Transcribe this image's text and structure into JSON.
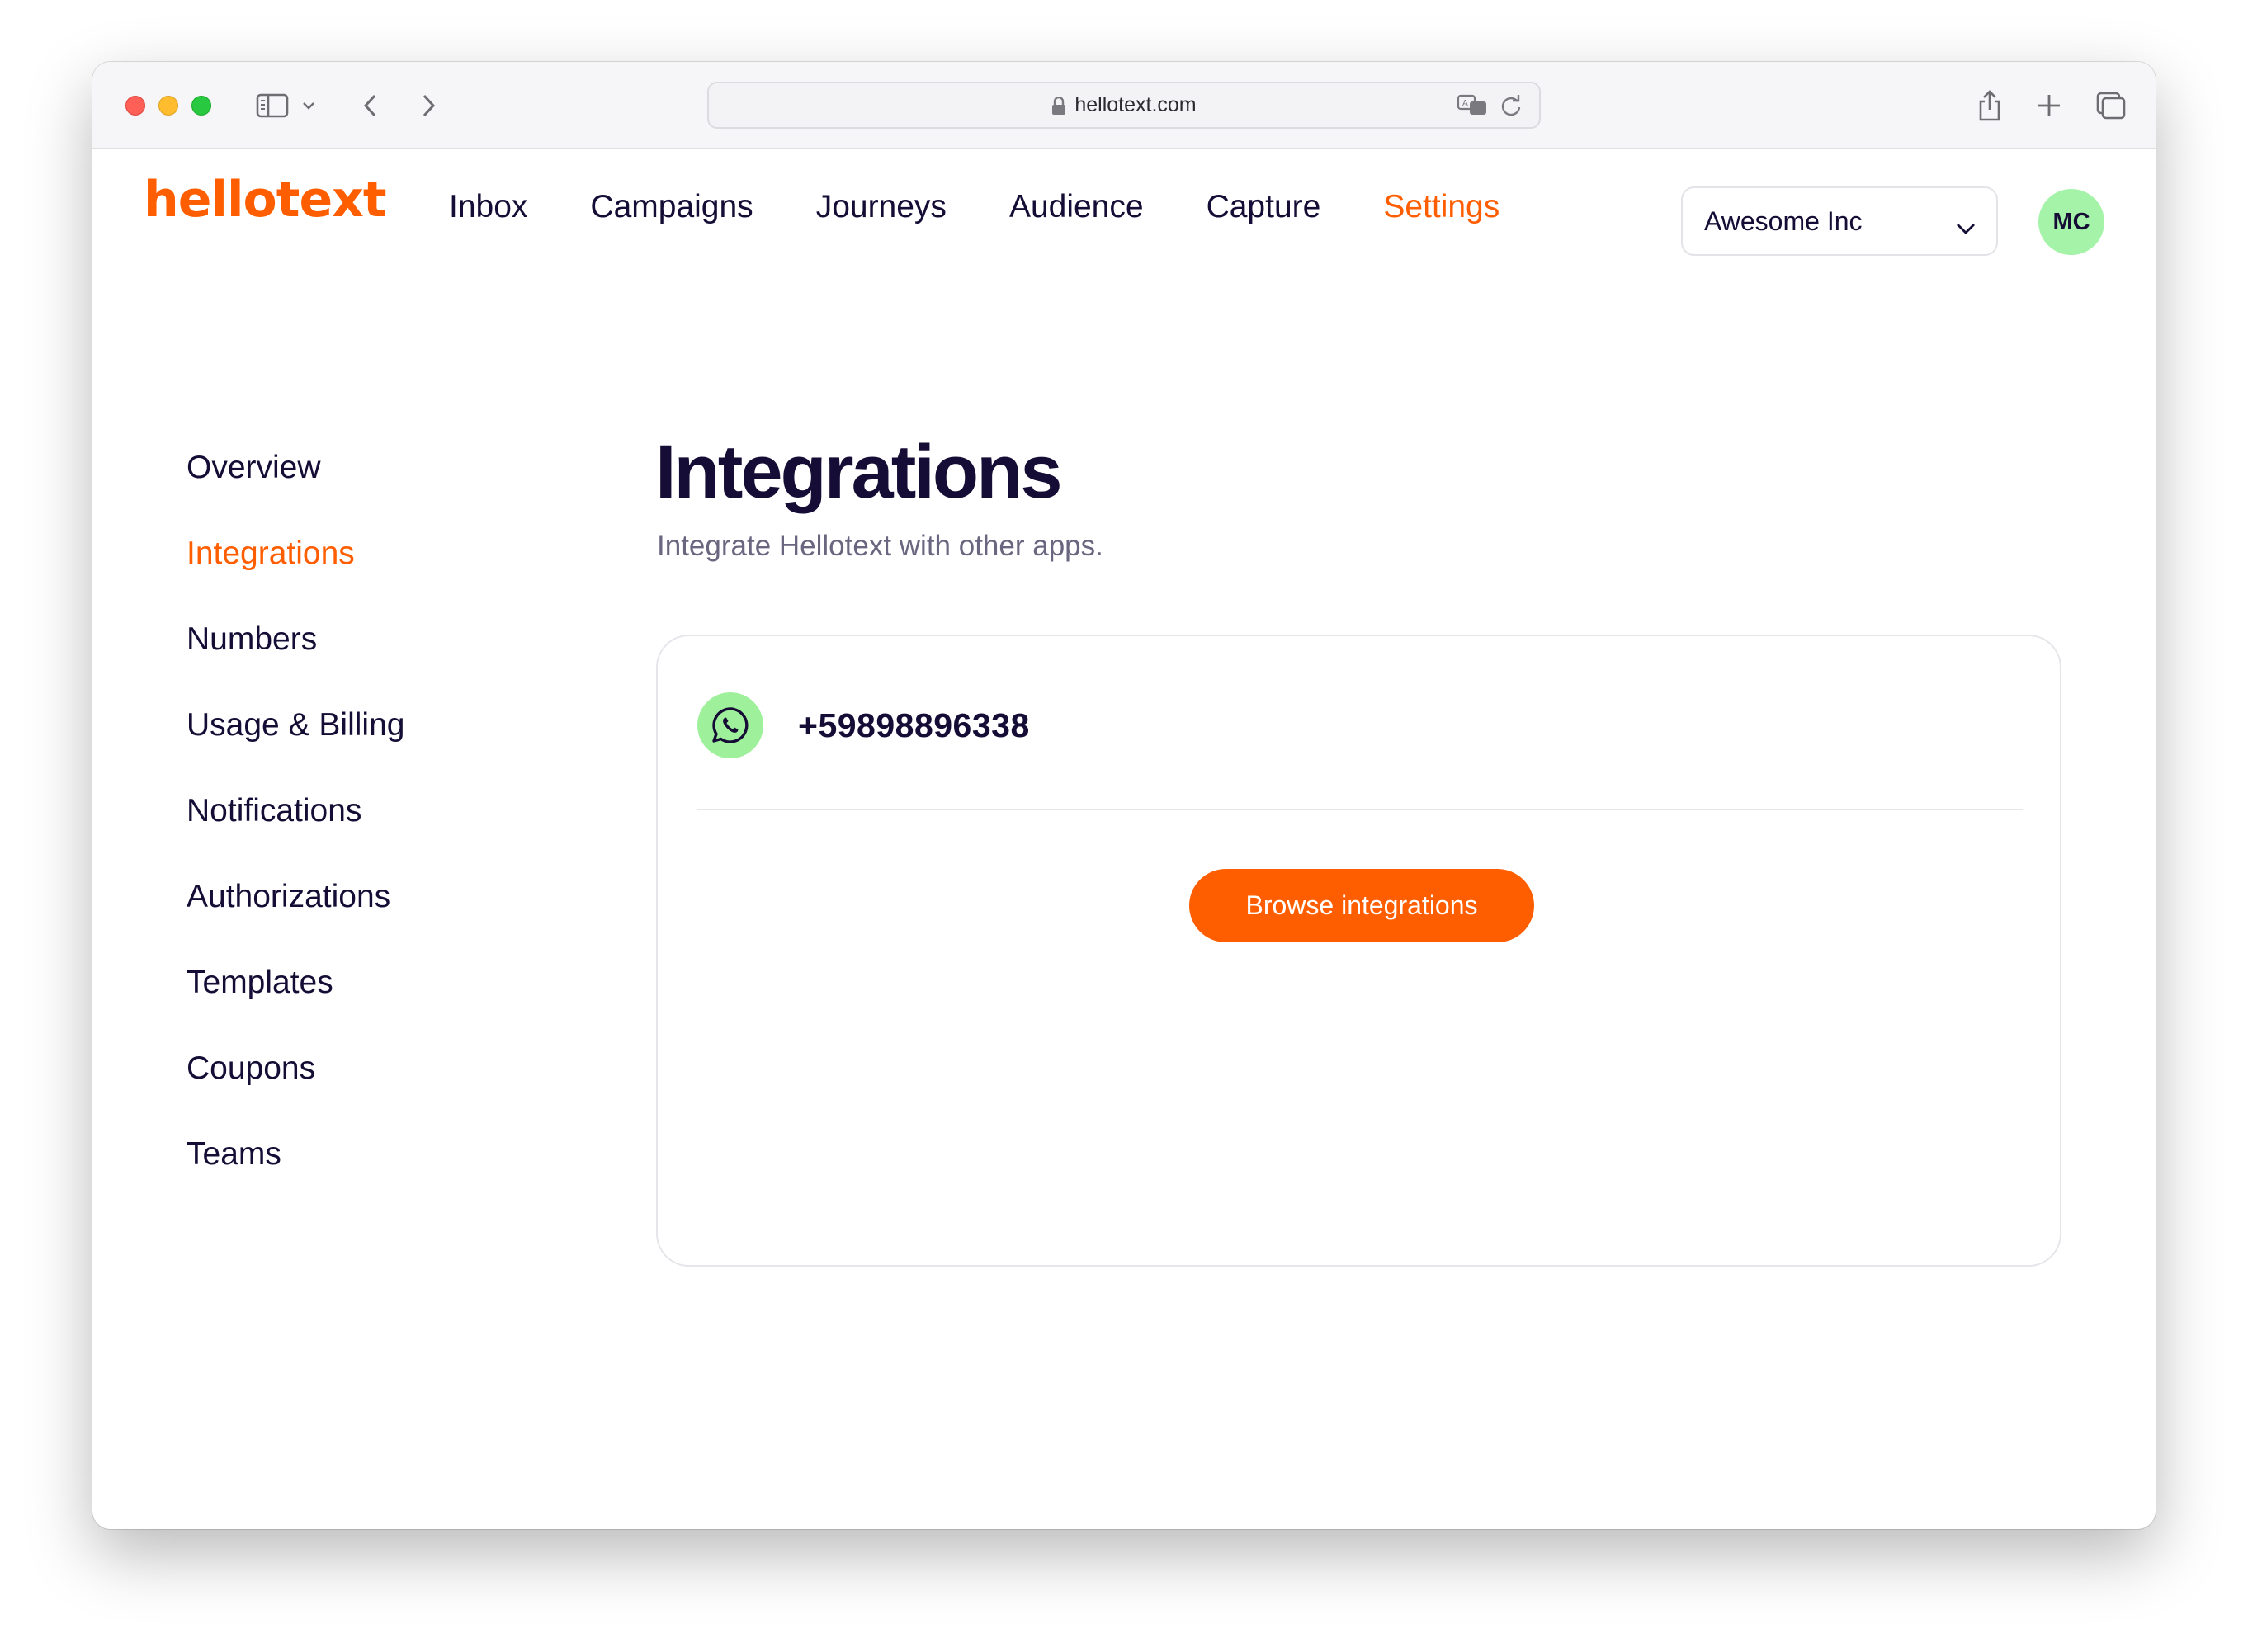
{
  "browser": {
    "url": "hellotext.com"
  },
  "header": {
    "logo": "hellotext",
    "nav": [
      {
        "label": "Inbox"
      },
      {
        "label": "Campaigns"
      },
      {
        "label": "Journeys"
      },
      {
        "label": "Audience"
      },
      {
        "label": "Capture"
      },
      {
        "label": "Settings",
        "active": true
      }
    ],
    "organization": "Awesome Inc",
    "avatar_initials": "MC"
  },
  "sidebar": {
    "items": [
      {
        "label": "Overview"
      },
      {
        "label": "Integrations",
        "active": true
      },
      {
        "label": "Numbers"
      },
      {
        "label": "Usage & Billing"
      },
      {
        "label": "Notifications"
      },
      {
        "label": "Authorizations"
      },
      {
        "label": "Templates"
      },
      {
        "label": "Coupons"
      },
      {
        "label": "Teams"
      }
    ]
  },
  "main": {
    "title": "Integrations",
    "subtitle": "Integrate Hellotext with other apps.",
    "integrations": [
      {
        "icon": "whatsapp-icon",
        "label": "+59898896338"
      }
    ],
    "browse_button": "Browse integrations"
  },
  "colors": {
    "brand": "#ff5e00",
    "text": "#150d35",
    "muted": "#6a6680",
    "avatar_bg": "#a5f3a8",
    "whatsapp_bg": "#9ef09b"
  }
}
